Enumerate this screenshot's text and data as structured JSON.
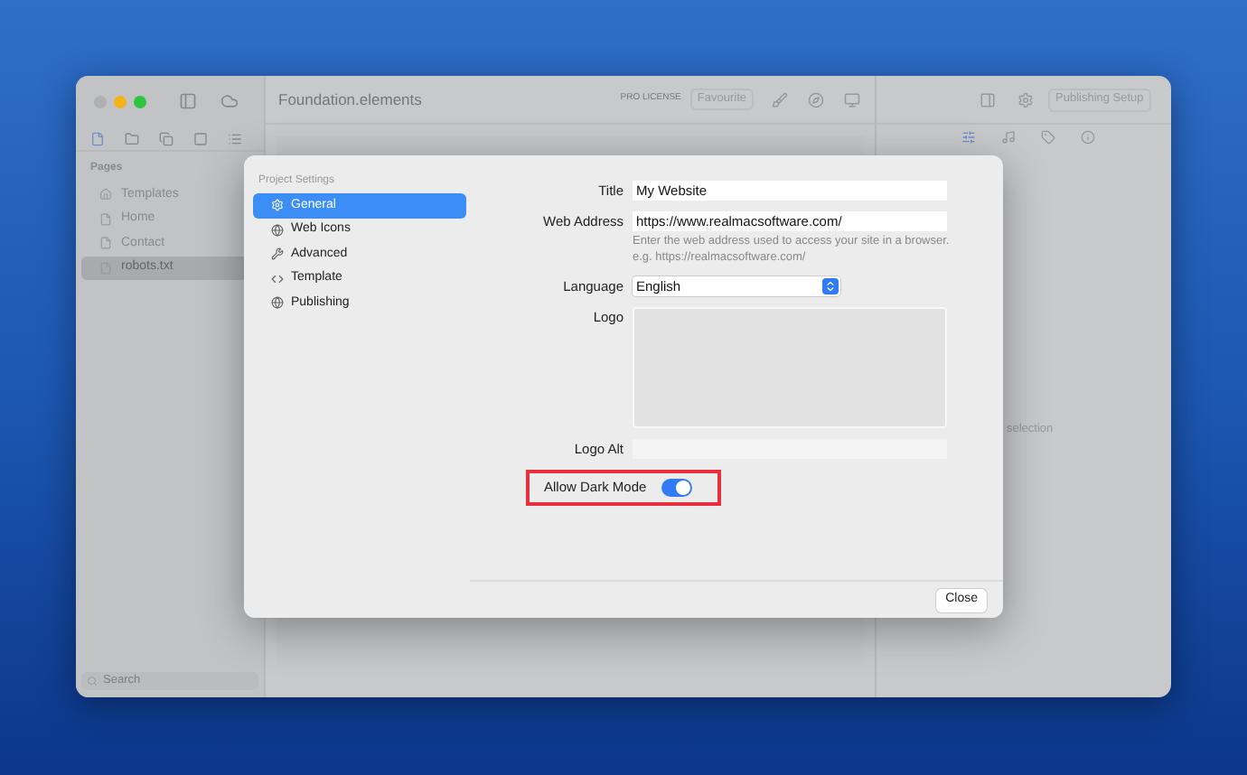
{
  "window": {
    "title": "Foundation.elements",
    "license": "PRO LICENSE",
    "favourite_button": "Favourite",
    "publishing_button": "Publishing Setup"
  },
  "sidebar": {
    "heading": "Pages",
    "items": [
      {
        "label": "Templates",
        "kind": "folder",
        "selected": false
      },
      {
        "label": "Home",
        "kind": "page",
        "selected": false
      },
      {
        "label": "Contact",
        "kind": "page",
        "selected": false
      },
      {
        "label": "robots.txt",
        "kind": "page",
        "selected": true
      }
    ],
    "search": {
      "placeholder": "Search"
    }
  },
  "inspector": {
    "tabs": [
      {
        "selected": true
      },
      {
        "selected": false
      },
      {
        "selected": false
      },
      {
        "selected": false
      }
    ],
    "note": "selection"
  },
  "dialog": {
    "heading": "Project Settings",
    "items": [
      {
        "label": "General",
        "selected": true
      },
      {
        "label": "Web Icons",
        "selected": false
      },
      {
        "label": "Advanced",
        "selected": false
      },
      {
        "label": "Template",
        "selected": false
      },
      {
        "label": "Publishing",
        "selected": false
      }
    ],
    "fields": [
      {
        "kind": "text",
        "label": "Title",
        "value": "My Website"
      },
      {
        "kind": "text",
        "label": "Web Address",
        "value": "https://www.realmacsoftware.com/",
        "hint": [
          "Enter the web address used to access your site in a browser.",
          "e.g. https://realmacsoftware.com/"
        ]
      },
      {
        "kind": "select",
        "label": "Language",
        "value": "English"
      },
      {
        "kind": "image",
        "label": "Logo"
      },
      {
        "kind": "text",
        "label": "Logo Alt"
      },
      {
        "kind": "switch",
        "label": "Allow Dark Mode",
        "on": true,
        "highlighted": true
      }
    ],
    "close_button": "Close"
  }
}
